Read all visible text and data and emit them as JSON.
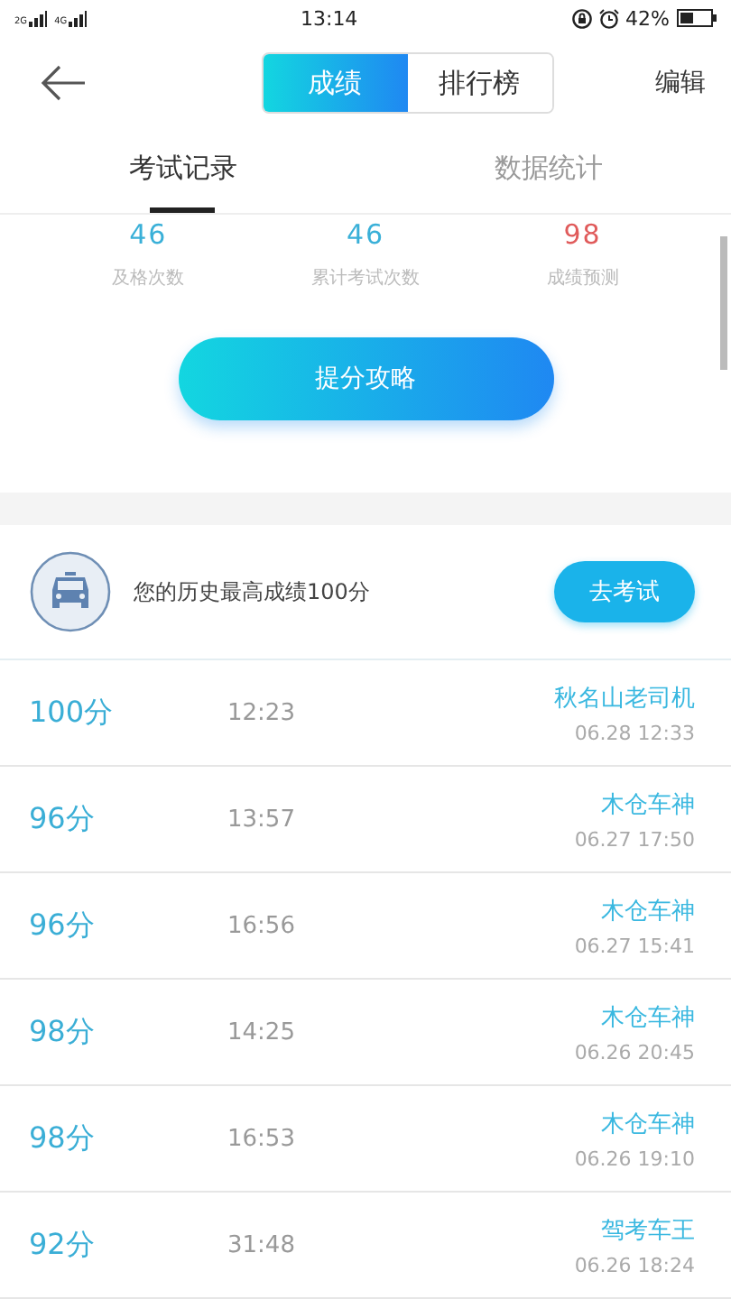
{
  "status_bar": {
    "signal_labels": [
      "2G",
      "4G"
    ],
    "time": "13:14",
    "battery": "42%"
  },
  "header": {
    "segments": [
      {
        "label": "成绩",
        "selected": true
      },
      {
        "label": "排行榜",
        "selected": false
      }
    ],
    "action": "编辑"
  },
  "tabs": [
    {
      "label": "考试记录",
      "selected": true
    },
    {
      "label": "数据统计",
      "selected": false
    }
  ],
  "stats": [
    {
      "value": "46",
      "label": "及格次数",
      "kind": "count"
    },
    {
      "value": "46",
      "label": "累计考试次数",
      "kind": "count"
    },
    {
      "value": "98",
      "label": "成绩预测",
      "kind": "prediction"
    }
  ],
  "tips_button": "提分攻略",
  "banner": {
    "text": "您的历史最高成绩100分",
    "button": "去考试"
  },
  "records": [
    {
      "score": "100分",
      "duration": "12:23",
      "name": "秋名山老司机",
      "date": "06.28 12:33"
    },
    {
      "score": "96分",
      "duration": "13:57",
      "name": "木仓车神",
      "date": "06.27 17:50"
    },
    {
      "score": "96分",
      "duration": "16:56",
      "name": "木仓车神",
      "date": "06.27 15:41"
    },
    {
      "score": "98分",
      "duration": "14:25",
      "name": "木仓车神",
      "date": "06.26 20:45"
    },
    {
      "score": "98分",
      "duration": "16:53",
      "name": "木仓车神",
      "date": "06.26 19:10"
    },
    {
      "score": "92分",
      "duration": "31:48",
      "name": "驾考车王",
      "date": "06.26 18:24"
    }
  ]
}
